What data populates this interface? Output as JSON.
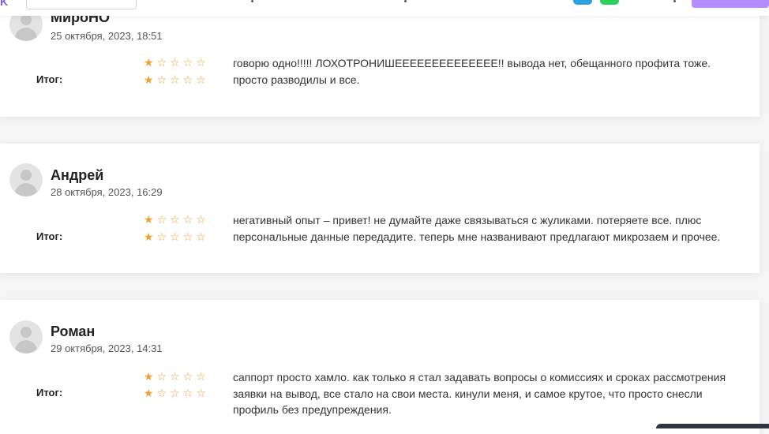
{
  "topbar": {
    "left_fragment": "K"
  },
  "reviews": [
    {
      "name": "МироНО",
      "date": "25 октября, 2023, 18:51",
      "summary_label": "Итог:",
      "rating": 1,
      "rating_max": 5,
      "text": "говорю одно!!!!! ЛОХОТРОНИШЕЕЕЕЕЕЕЕЕЕЕЕЕЕ!! вывода нет, обещанного профита тоже. просто разводилы и все."
    },
    {
      "name": "Андрей",
      "date": "28 октября, 2023, 16:29",
      "summary_label": "Итог:",
      "rating": 1,
      "rating_max": 5,
      "text": "негативный опыт – привет! не думайте даже связываться с жуликами. потеряете все. плюс персональные данные передадите. теперь мне названивают предлагают микрозаем и прочее."
    },
    {
      "name": "Роман",
      "date": "29 октября, 2023, 14:31",
      "summary_label": "Итог:",
      "rating": 1,
      "rating_max": 5,
      "text": "саппорт просто хамло. как только я стал задавать вопросы о комиссиях и сроках рассмотрения заявки на вывод, все стало на свои места. кинули меня, и самое крутое, что просто снесли профиль без предупреждения."
    }
  ],
  "icons": {
    "star_filled": "star-filled-icon",
    "star_empty": "star-outline-icon"
  },
  "colors": {
    "star": "#f0a030",
    "accent": "#b48cff"
  }
}
